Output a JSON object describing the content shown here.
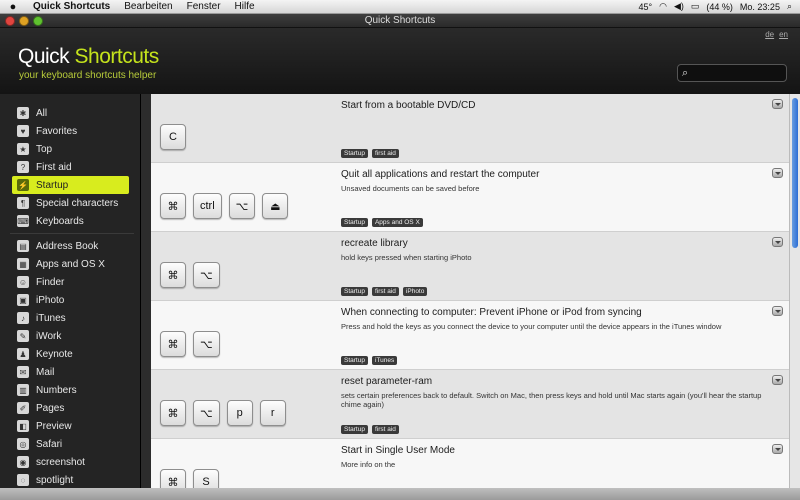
{
  "menubar": {
    "apple": "",
    "items": [
      "Quick Shortcuts",
      "Bearbeiten",
      "Fenster",
      "Hilfe"
    ],
    "temp": "45°",
    "battery": "(44 %)",
    "clock": "Mo. 23:25"
  },
  "window": {
    "title": "Quick Shortcuts"
  },
  "header": {
    "brand_a": "Quick",
    "brand_b": "Shortcuts",
    "tagline": "your keyboard shortcuts helper",
    "lang": [
      "de",
      "en"
    ],
    "search_value": ""
  },
  "sidebar": {
    "groups": [
      [
        {
          "label": "All",
          "icon": "✱"
        },
        {
          "label": "Favorites",
          "icon": "♥"
        },
        {
          "label": "Top",
          "icon": "★"
        },
        {
          "label": "First aid",
          "icon": "?"
        },
        {
          "label": "Startup",
          "icon": "⚡",
          "selected": true
        },
        {
          "label": "Special characters",
          "icon": "¶"
        },
        {
          "label": "Keyboards",
          "icon": "⌨"
        }
      ],
      [
        {
          "label": "Address Book",
          "icon": "▤"
        },
        {
          "label": "Apps and OS X",
          "icon": "▦"
        },
        {
          "label": "Finder",
          "icon": "☺"
        },
        {
          "label": "iPhoto",
          "icon": "▣"
        },
        {
          "label": "iTunes",
          "icon": "♪"
        },
        {
          "label": "iWork",
          "icon": "✎"
        },
        {
          "label": "Keynote",
          "icon": "♟"
        },
        {
          "label": "Mail",
          "icon": "✉"
        },
        {
          "label": "Numbers",
          "icon": "▥"
        },
        {
          "label": "Pages",
          "icon": "✐"
        },
        {
          "label": "Preview",
          "icon": "◧"
        },
        {
          "label": "Safari",
          "icon": "◎"
        },
        {
          "label": "screenshot",
          "icon": "◉"
        },
        {
          "label": "spotlight",
          "icon": "◌"
        }
      ]
    ]
  },
  "shortcuts": [
    {
      "keys": [
        "C"
      ],
      "title": "Start from a bootable DVD/CD",
      "desc": "",
      "tags": [
        "Startup",
        "first aid"
      ]
    },
    {
      "keys": [
        "⌘",
        "ctrl",
        "⌥",
        "⏏"
      ],
      "title": "Quit all applications and restart the computer",
      "desc": "Unsaved documents can be saved before",
      "tags": [
        "Startup",
        "Apps and OS X"
      ]
    },
    {
      "keys": [
        "⌘",
        "⌥"
      ],
      "title": "recreate library",
      "desc": "hold keys pressed when starting iPhoto",
      "tags": [
        "Startup",
        "first aid",
        "iPhoto"
      ]
    },
    {
      "keys": [
        "⌘",
        "⌥"
      ],
      "title": "When connecting to computer: Prevent iPhone or iPod from syncing",
      "desc": "Press and hold the keys as you connect the device to your computer until the device appears in the iTunes window",
      "tags": [
        "Startup",
        "iTunes"
      ]
    },
    {
      "keys": [
        "⌘",
        "⌥",
        "p",
        "r"
      ],
      "title": "reset parameter-ram",
      "desc": "sets certain preferences back to default. Switch on Mac, then press keys and hold until Mac starts again (you'll hear the startup chime again)",
      "tags": [
        "Startup",
        "first aid"
      ]
    },
    {
      "keys": [
        "⌘",
        "S"
      ],
      "title": "Start in Single User Mode",
      "desc": "More info on the",
      "tags": []
    }
  ],
  "colors": {
    "accent": "#c4e21c",
    "selection": "#d8ec1e"
  }
}
